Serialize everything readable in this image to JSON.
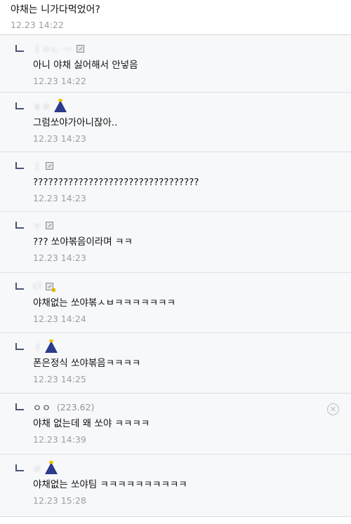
{
  "post": {
    "text": "야채는 니가다먹었어?",
    "time": "12.23 14:22"
  },
  "replies": [
    {
      "nick": "ㅣㅇㄴ ㅡ",
      "badge": "doc-icon",
      "text": "아니 야채 싫어해서 안넣음",
      "time": "12.23 14:22",
      "height": 82
    },
    {
      "nick": "ㅎㄹ",
      "badge": "tree-icon",
      "text": "그럼쏘야가아니잖아..",
      "time": "12.23 14:23",
      "height": 85
    },
    {
      "nick": "ㅣ",
      "badge": "doc-icon",
      "text": "?????????????????????????????????",
      "time": "12.23 14:23",
      "height": 85
    },
    {
      "nick": "ㅜ",
      "badge": "doc-icon",
      "text": "??? 쏘야볶음이라며 ㅋㅋ",
      "time": "12.23 14:23",
      "height": 87
    },
    {
      "nick": "ci",
      "badge": "doc-lock-icon",
      "text": "야채없는 쏘야볶ㅅㅂㅋㅋㅋㅋㅋㅋㅋ",
      "time": "12.23 14:24",
      "height": 86
    },
    {
      "nick": "ㅓ",
      "badge": "tree-icon",
      "text": "폰은정식 쏘야볶음ㅋㅋㅋㅋ",
      "time": "12.23 14:25",
      "height": 86
    },
    {
      "nick": "ㅇㅇ",
      "ip": "(223.62)",
      "badge": "",
      "text": "야채 없는데 왜 쏘야 ㅋㅋㅋㅋ",
      "time": "12.23 14:39",
      "height": 87,
      "deletable": true
    },
    {
      "nick": "ㄹ",
      "badge": "tree-icon",
      "text": "야채없는 쏘야팀 ㅋㅋㅋㅋㅋㅋㅋㅋㅋㅋ",
      "time": "12.23 15:28",
      "height": 89
    }
  ],
  "delete_glyph": "✕"
}
